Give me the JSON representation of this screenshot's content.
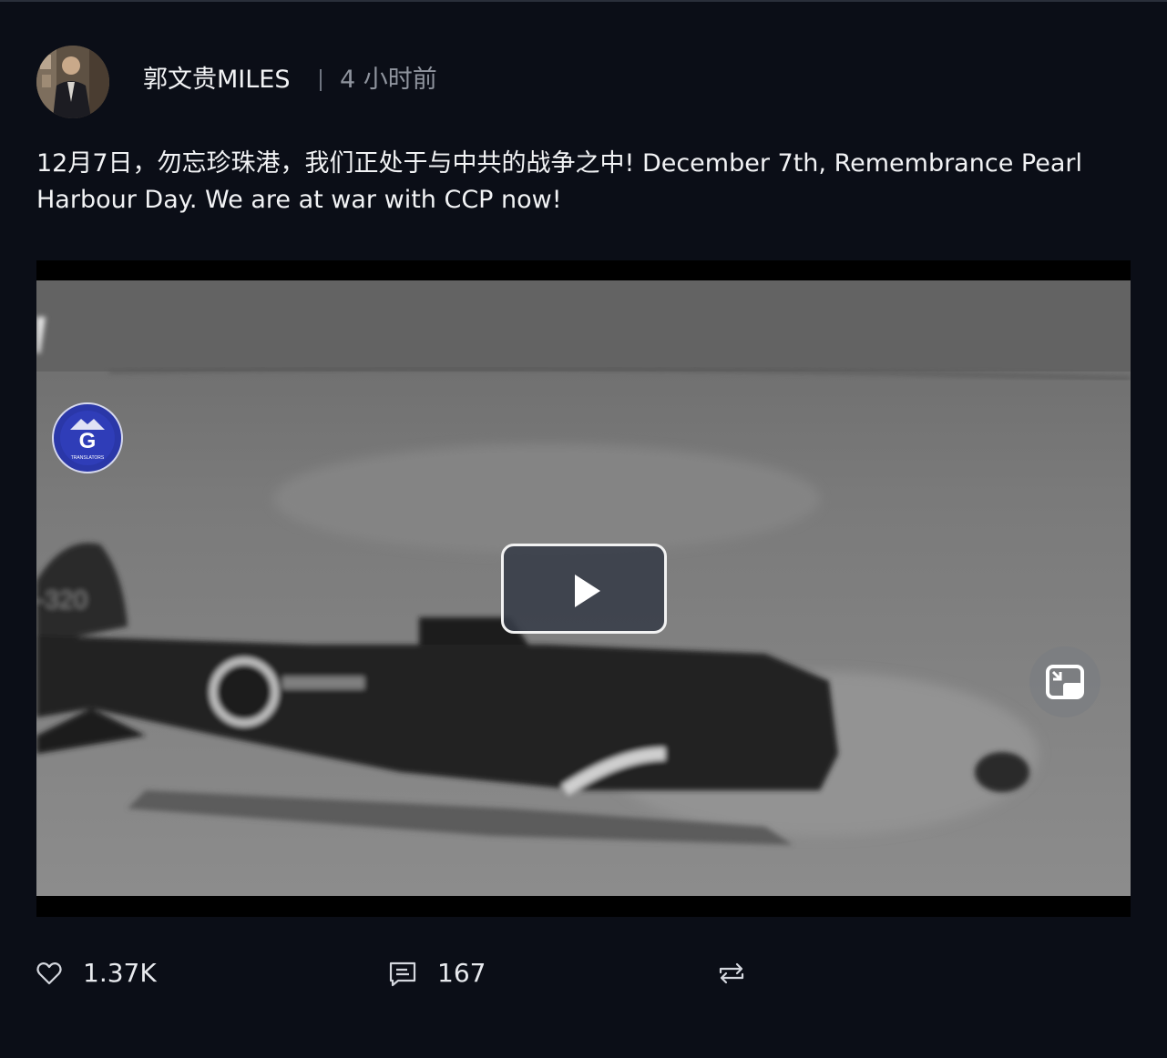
{
  "post": {
    "author": "郭文贵MILES",
    "separator": "|",
    "time": "4 小时前",
    "text": "12月7日，勿忘珍珠港，我们正处于与中共的战争之中! December 7th, Remembrance Pearl Harbour Day. We are at war with CCP now!"
  },
  "video": {
    "overlay_logo_letter": "G",
    "overlay_logo_text": "TRANSLATORS",
    "play_icon": "play-icon",
    "pip_icon": "picture-in-picture-icon"
  },
  "actions": {
    "likes": "1.37K",
    "comments": "167",
    "like_icon": "heart-icon",
    "comment_icon": "comment-icon",
    "repost_icon": "repost-icon"
  },
  "colors": {
    "background": "#0b0e17",
    "text": "#f2f3f5",
    "muted": "#8f949e",
    "logo_blue": "#2a37a8"
  }
}
